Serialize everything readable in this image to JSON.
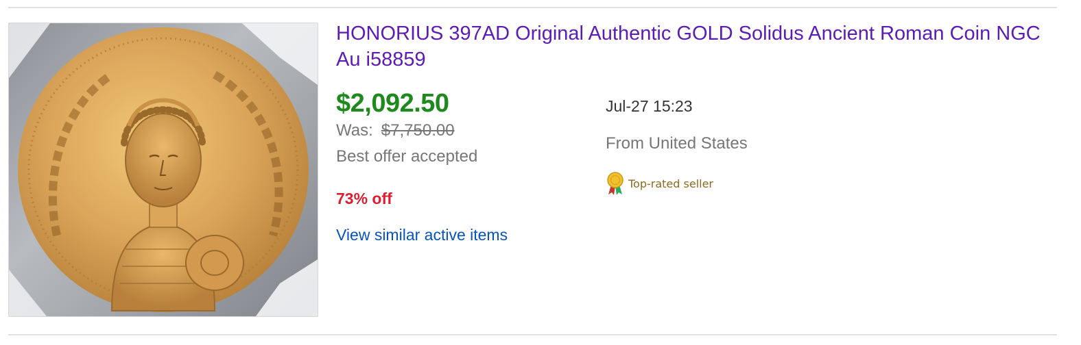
{
  "listing": {
    "title": "HONORIUS 397AD Original Authentic GOLD Solidus Ancient Roman Coin NGC Au i58859",
    "image_icon": "coin-photo",
    "price": "$2,092.50",
    "was_label": "Was:",
    "was_price": "$7,750.00",
    "best_offer": "Best offer accepted",
    "discount": "73% off",
    "similar_link": "View similar active items",
    "end_date": "Jul-27 15:23",
    "location": "From United States",
    "seller_badge": "Top-rated seller",
    "badge_icon": "ribbon-medal-icon"
  },
  "colors": {
    "title": "#5d1bb5",
    "price": "#1e8a1e",
    "discount": "#dd1e31",
    "link": "#0654ba",
    "muted": "#767676"
  }
}
